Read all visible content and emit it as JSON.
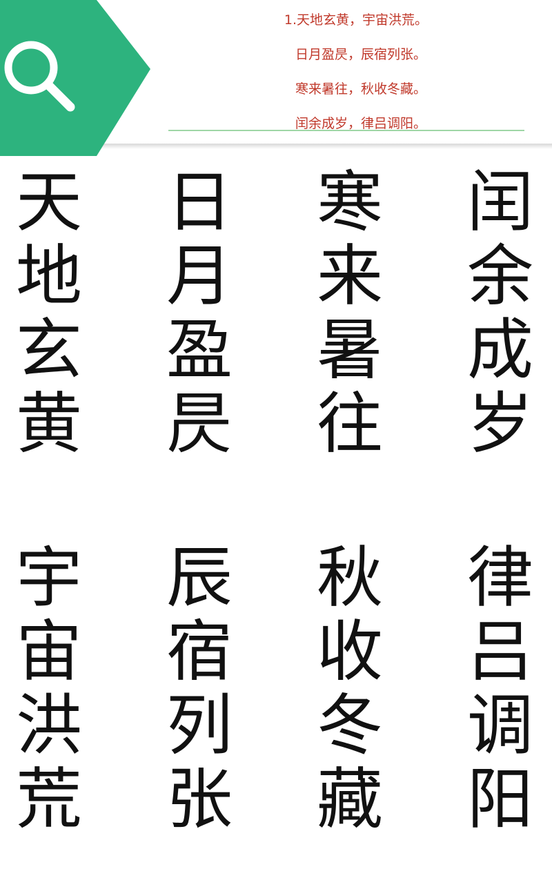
{
  "colors": {
    "accent_green": "#2db37e",
    "poem_red": "#c0392b",
    "rule_green": "#9fd6a6",
    "ink": "#111111"
  },
  "header": {
    "search_icon": "search-icon",
    "poem_lines": [
      "1.天地玄黄，宇宙洪荒。",
      "日月盈昃，辰宿列张。",
      "寒来暑往，秋收冬藏。",
      "闰余成岁，律吕调阳。"
    ]
  },
  "seal_columns": [
    {
      "chars": [
        "天",
        "地",
        "玄",
        "黄"
      ]
    },
    {
      "chars": [
        "日",
        "月",
        "盈",
        "昃"
      ]
    },
    {
      "chars": [
        "寒",
        "来",
        "暑",
        "往"
      ]
    },
    {
      "chars": [
        "闰",
        "余",
        "成",
        "岁"
      ]
    },
    {
      "chars": [
        "宇",
        "宙",
        "洪",
        "荒"
      ]
    },
    {
      "chars": [
        "辰",
        "宿",
        "列",
        "张"
      ]
    },
    {
      "chars": [
        "秋",
        "收",
        "冬",
        "藏"
      ]
    },
    {
      "chars": [
        "律",
        "吕",
        "调",
        "阳"
      ]
    }
  ]
}
